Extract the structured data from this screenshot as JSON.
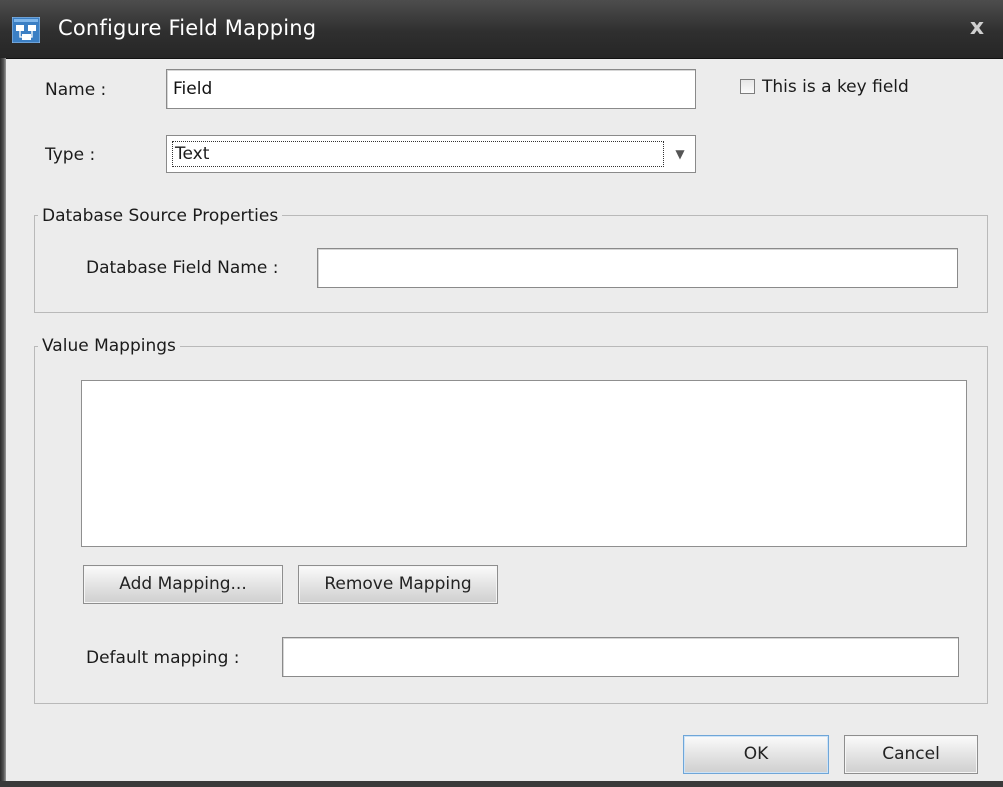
{
  "window": {
    "title": "Configure Field Mapping",
    "close_label": "x"
  },
  "form": {
    "name_label": "Name :",
    "name_value": "Field",
    "key_field_label": "This is a key field",
    "key_field_checked": false,
    "type_label": "Type :",
    "type_value": "Text"
  },
  "database_source": {
    "title": "Database Source Properties",
    "field_name_label": "Database Field Name :",
    "field_name_value": ""
  },
  "value_mappings": {
    "title": "Value Mappings",
    "items": [],
    "add_button": "Add Mapping...",
    "remove_button": "Remove Mapping",
    "default_label": "Default mapping :",
    "default_value": ""
  },
  "buttons": {
    "ok": "OK",
    "cancel": "Cancel"
  },
  "colors": {
    "titlebar": "#2f2f2f",
    "background": "#ececec",
    "default_button_border": "#6fa6d8"
  }
}
